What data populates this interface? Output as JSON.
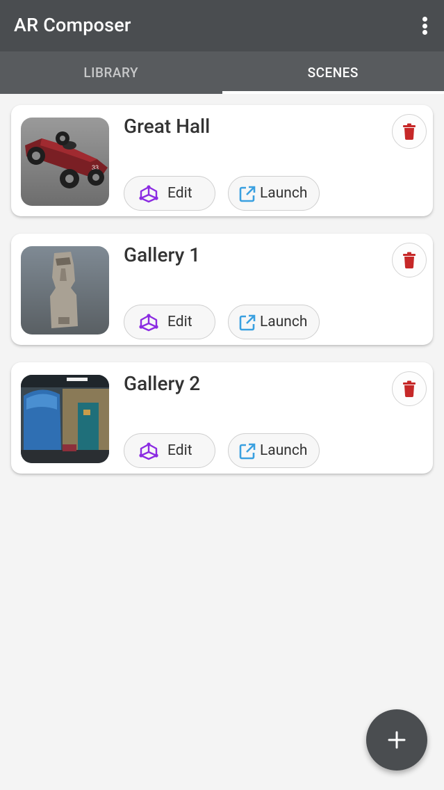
{
  "app": {
    "title": "AR Composer"
  },
  "tabs": [
    {
      "label": "LIBRARY",
      "active": false
    },
    {
      "label": "SCENES",
      "active": true
    }
  ],
  "scenes": [
    {
      "title": "Great Hall",
      "thumbnail": "red-race-car",
      "edit_label": "Edit",
      "launch_label": "Launch"
    },
    {
      "title": "Gallery 1",
      "thumbnail": "moai-statue",
      "edit_label": "Edit",
      "launch_label": "Launch"
    },
    {
      "title": "Gallery 2",
      "thumbnail": "industrial-room-blue-tank",
      "edit_label": "Edit",
      "launch_label": "Launch"
    }
  ],
  "colors": {
    "appbar": "#4a4d50",
    "tabbar": "#585b5e",
    "edit_icon": "#8b2be2",
    "launch_icon": "#3aa0e0",
    "delete_icon": "#c62828"
  },
  "icons": {
    "overflow": "more-vert-icon",
    "edit": "cube-icon",
    "launch": "open-external-icon",
    "delete": "trash-icon",
    "fab": "plus-icon"
  }
}
